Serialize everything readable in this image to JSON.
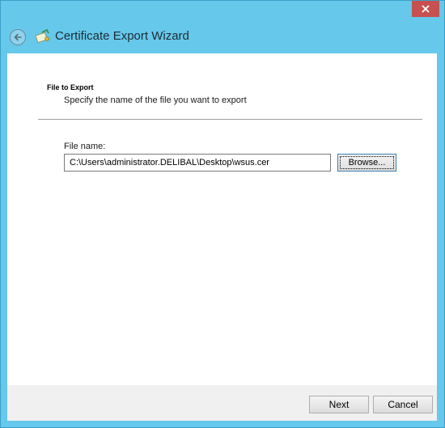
{
  "window": {
    "title": "Certificate Export Wizard",
    "close_icon": "close-icon",
    "back_icon": "back-arrow-icon",
    "wizard_icon": "certificate-wizard-icon"
  },
  "page": {
    "heading": "File to Export",
    "description": "Specify the name of the file you want to export"
  },
  "file_field": {
    "label": "File name:",
    "value": "C:\\Users\\administrator.DELIBAL\\Desktop\\wsus.cer"
  },
  "buttons": {
    "browse": "Browse...",
    "next": "Next",
    "cancel": "Cancel"
  },
  "colors": {
    "frame": "#66c8ea",
    "close": "#c75050",
    "content_bg": "#ffffff",
    "footer_bg": "#f0f0f0"
  }
}
